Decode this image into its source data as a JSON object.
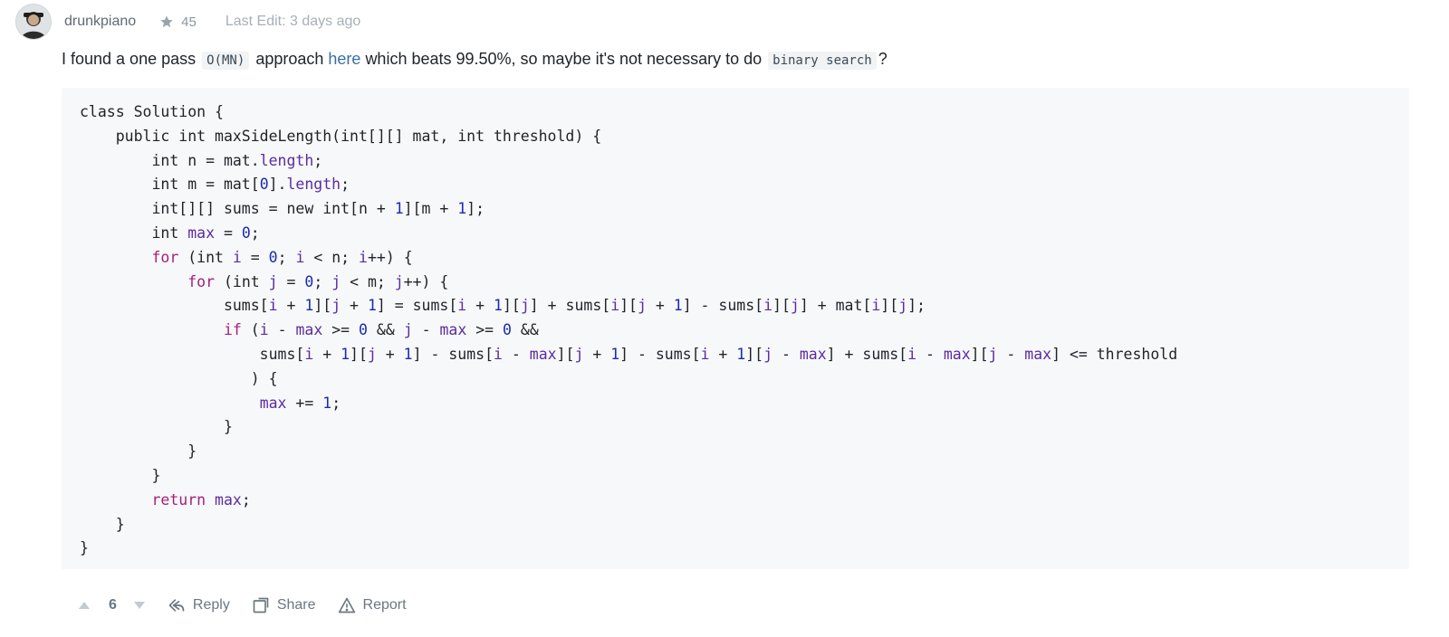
{
  "post": {
    "author": "drunkpiano",
    "stars": "45",
    "last_edit": "Last Edit: 3 days ago"
  },
  "comment": {
    "part1": "I found a one pass",
    "code1": "O(MN)",
    "part2": "approach",
    "link_text": "here",
    "part3": "which beats 99.50%, so maybe it's not necessary to do",
    "code2": "binary search",
    "part4": "?"
  },
  "actions": {
    "votes": "6",
    "reply": "Reply",
    "share": "Share",
    "report": "Report"
  },
  "code_lines": [
    [
      [
        "t",
        "class Solution {"
      ]
    ],
    [
      [
        "t",
        "    public int maxSideLength(int[][] mat, int threshold) {"
      ]
    ],
    [
      [
        "t",
        "        int n = mat."
      ],
      [
        "i",
        "length"
      ],
      [
        "t",
        ";"
      ]
    ],
    [
      [
        "t",
        "        int m = mat["
      ],
      [
        "n",
        "0"
      ],
      [
        "t",
        "]."
      ],
      [
        "i",
        "length"
      ],
      [
        "t",
        ";"
      ]
    ],
    [
      [
        "t",
        "        int[][] sums = new int[n + "
      ],
      [
        "n",
        "1"
      ],
      [
        "t",
        "][m + "
      ],
      [
        "n",
        "1"
      ],
      [
        "t",
        "];"
      ]
    ],
    [
      [
        "t",
        "        int "
      ],
      [
        "i",
        "max"
      ],
      [
        "t",
        " = "
      ],
      [
        "n",
        "0"
      ],
      [
        "t",
        ";"
      ]
    ],
    [
      [
        "t",
        "        "
      ],
      [
        "k",
        "for"
      ],
      [
        "t",
        " (int "
      ],
      [
        "i",
        "i"
      ],
      [
        "t",
        " = "
      ],
      [
        "n",
        "0"
      ],
      [
        "t",
        "; "
      ],
      [
        "i",
        "i"
      ],
      [
        "t",
        " < n; "
      ],
      [
        "i",
        "i"
      ],
      [
        "t",
        "++) {"
      ]
    ],
    [
      [
        "t",
        "            "
      ],
      [
        "k",
        "for"
      ],
      [
        "t",
        " (int "
      ],
      [
        "i",
        "j"
      ],
      [
        "t",
        " = "
      ],
      [
        "n",
        "0"
      ],
      [
        "t",
        "; "
      ],
      [
        "i",
        "j"
      ],
      [
        "t",
        " < m; "
      ],
      [
        "i",
        "j"
      ],
      [
        "t",
        "++) {"
      ]
    ],
    [
      [
        "t",
        "                sums["
      ],
      [
        "i",
        "i"
      ],
      [
        "t",
        " + "
      ],
      [
        "n",
        "1"
      ],
      [
        "t",
        "]["
      ],
      [
        "i",
        "j"
      ],
      [
        "t",
        " + "
      ],
      [
        "n",
        "1"
      ],
      [
        "t",
        "] = sums["
      ],
      [
        "i",
        "i"
      ],
      [
        "t",
        " + "
      ],
      [
        "n",
        "1"
      ],
      [
        "t",
        "]["
      ],
      [
        "i",
        "j"
      ],
      [
        "t",
        "] + sums["
      ],
      [
        "i",
        "i"
      ],
      [
        "t",
        "]["
      ],
      [
        "i",
        "j"
      ],
      [
        "t",
        " + "
      ],
      [
        "n",
        "1"
      ],
      [
        "t",
        "] - sums["
      ],
      [
        "i",
        "i"
      ],
      [
        "t",
        "]["
      ],
      [
        "i",
        "j"
      ],
      [
        "t",
        "] + mat["
      ],
      [
        "i",
        "i"
      ],
      [
        "t",
        "]["
      ],
      [
        "i",
        "j"
      ],
      [
        "t",
        "];"
      ]
    ],
    [
      [
        "t",
        "                "
      ],
      [
        "k",
        "if"
      ],
      [
        "t",
        " ("
      ],
      [
        "i",
        "i"
      ],
      [
        "t",
        " - "
      ],
      [
        "i",
        "max"
      ],
      [
        "t",
        " >= "
      ],
      [
        "n",
        "0"
      ],
      [
        "t",
        " && "
      ],
      [
        "i",
        "j"
      ],
      [
        "t",
        " - "
      ],
      [
        "i",
        "max"
      ],
      [
        "t",
        " >= "
      ],
      [
        "n",
        "0"
      ],
      [
        "t",
        " &&"
      ]
    ],
    [
      [
        "t",
        "                    sums["
      ],
      [
        "i",
        "i"
      ],
      [
        "t",
        " + "
      ],
      [
        "n",
        "1"
      ],
      [
        "t",
        "]["
      ],
      [
        "i",
        "j"
      ],
      [
        "t",
        " + "
      ],
      [
        "n",
        "1"
      ],
      [
        "t",
        "] - sums["
      ],
      [
        "i",
        "i"
      ],
      [
        "t",
        " - "
      ],
      [
        "i",
        "max"
      ],
      [
        "t",
        "]["
      ],
      [
        "i",
        "j"
      ],
      [
        "t",
        " + "
      ],
      [
        "n",
        "1"
      ],
      [
        "t",
        "] - sums["
      ],
      [
        "i",
        "i"
      ],
      [
        "t",
        " + "
      ],
      [
        "n",
        "1"
      ],
      [
        "t",
        "]["
      ],
      [
        "i",
        "j"
      ],
      [
        "t",
        " - "
      ],
      [
        "i",
        "max"
      ],
      [
        "t",
        "] + sums["
      ],
      [
        "i",
        "i"
      ],
      [
        "t",
        " - "
      ],
      [
        "i",
        "max"
      ],
      [
        "t",
        "]["
      ],
      [
        "i",
        "j"
      ],
      [
        "t",
        " - "
      ],
      [
        "i",
        "max"
      ],
      [
        "t",
        "] <= threshold"
      ]
    ],
    [
      [
        "t",
        "                   ) {"
      ]
    ],
    [
      [
        "t",
        "                    "
      ],
      [
        "i",
        "max"
      ],
      [
        "t",
        " += "
      ],
      [
        "n",
        "1"
      ],
      [
        "t",
        ";"
      ]
    ],
    [
      [
        "t",
        "                }"
      ]
    ],
    [
      [
        "t",
        "            }"
      ]
    ],
    [
      [
        "t",
        "        }"
      ]
    ],
    [
      [
        "t",
        "        "
      ],
      [
        "k",
        "return"
      ],
      [
        "t",
        " "
      ],
      [
        "i",
        "max"
      ],
      [
        "t",
        ";"
      ]
    ],
    [
      [
        "t",
        "    }"
      ]
    ],
    [
      [
        "t",
        "}"
      ]
    ]
  ],
  "colors": {
    "keyword": "#a61e7a",
    "number": "#1b2bb0",
    "identifier": "#5a2ca0",
    "link": "#3a6ea5"
  },
  "icons": {
    "star": "star-icon",
    "upvote": "upvote-icon",
    "downvote": "downvote-icon",
    "reply": "reply-icon",
    "share": "share-icon",
    "report": "report-icon"
  }
}
